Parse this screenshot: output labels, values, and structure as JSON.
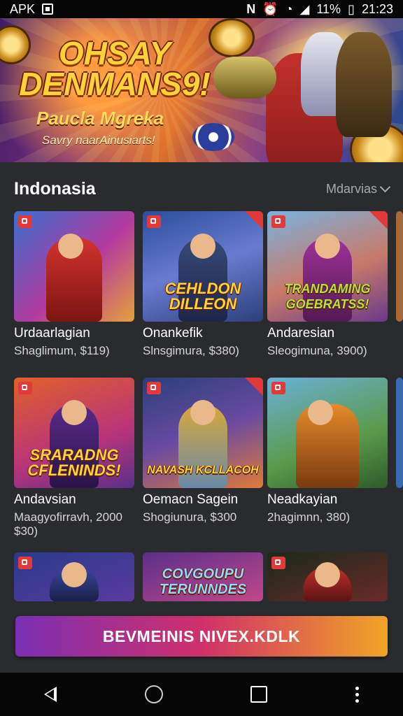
{
  "status": {
    "app": "APK",
    "notification": "N",
    "battery": "11%",
    "time": "21:23"
  },
  "banner": {
    "title_line1": "OHSAY",
    "title_line2": "DENMANS9!",
    "subtitle": "Paucla Mgreka",
    "tagline": "Savry naarAinusiarts!"
  },
  "section": {
    "title": "Indonasia",
    "more_label": "Mdarvias"
  },
  "cards": [
    {
      "title": "Urdaarlagian",
      "subtitle": "Shaglimum, $119)",
      "thumb_text": ""
    },
    {
      "title": "Onankefik",
      "subtitle": "Slnsgimura, $380)",
      "thumb_text": "CEHLDON DILLEON"
    },
    {
      "title": "Andaresian",
      "subtitle": "Sleogimuna, 3900)",
      "thumb_text": "TRANDAMING GOEBRATSS!"
    },
    {
      "title": "Andavsian",
      "subtitle": "Maagyofirravh, 2000 $30)",
      "thumb_text": "SRARADNG CFLENINDS!"
    },
    {
      "title": "Oemacn Sagein",
      "subtitle": "Shogiunura, $300",
      "thumb_text": "NAVASH KCLLACOH"
    },
    {
      "title": "Neadkayian",
      "subtitle": "2hagimnn, 380)",
      "thumb_text": ""
    },
    {
      "title": "",
      "subtitle": "",
      "thumb_text": ""
    },
    {
      "title": "",
      "subtitle": "",
      "thumb_text": "COVGOUPU TERUNNDES"
    },
    {
      "title": "",
      "subtitle": "",
      "thumb_text": ""
    }
  ],
  "cta": {
    "label": "BEVMEINIS NIVEX.KDLK"
  },
  "colors": {
    "accent_red": "#e23a3a",
    "gold": "#ffd33d",
    "cta_start": "#7a2fb4",
    "cta_end": "#f0a526"
  }
}
